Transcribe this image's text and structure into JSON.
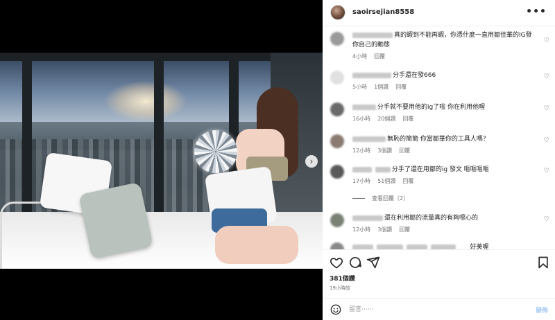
{
  "post": {
    "username": "saoirsejian8558",
    "more_icon": "more-horizontal-icon",
    "likes": "381個讚",
    "time": "19小時前",
    "carousel_dots": 2
  },
  "comments": [
    {
      "text": "真的蝦到不能再蝦，你憑什麼一直用鄒佳華的IG發你自己的動態",
      "time": "4小時",
      "likes": "",
      "reply": "回覆"
    },
    {
      "text": "分手還在發666",
      "time": "5小時",
      "likes": "1個讚",
      "reply": "回覆"
    },
    {
      "text": "分手就不要用他的ig了啦 你在利用他喔",
      "time": "16小時",
      "likes": "20個讚",
      "reply": "回覆"
    },
    {
      "text": "無恥的簡簡 你當鄒華你的工具人嗎？",
      "time": "12小時",
      "likes": "3個讚",
      "reply": "回覆"
    },
    {
      "text": "分手了還在用鄒的ig 發文 嘔嘔嘔嘔",
      "time": "17小時",
      "likes": "51個讚",
      "reply": "回覆"
    },
    {
      "text": "還在利用鄒的流量真的有夠噁心的",
      "time": "12小時",
      "likes": "3個讚",
      "reply": "回覆"
    },
    {
      "text": "好美喔",
      "time": "",
      "likes": "",
      "reply": ""
    }
  ],
  "view_replies": "查看回覆（2）",
  "comment_bar": {
    "placeholder": "留言⋯⋯",
    "post_label": "發佈"
  },
  "colors": {
    "text": "#262626",
    "muted": "#737373",
    "post_button": "#9fc8f5",
    "border": "#efefef"
  }
}
